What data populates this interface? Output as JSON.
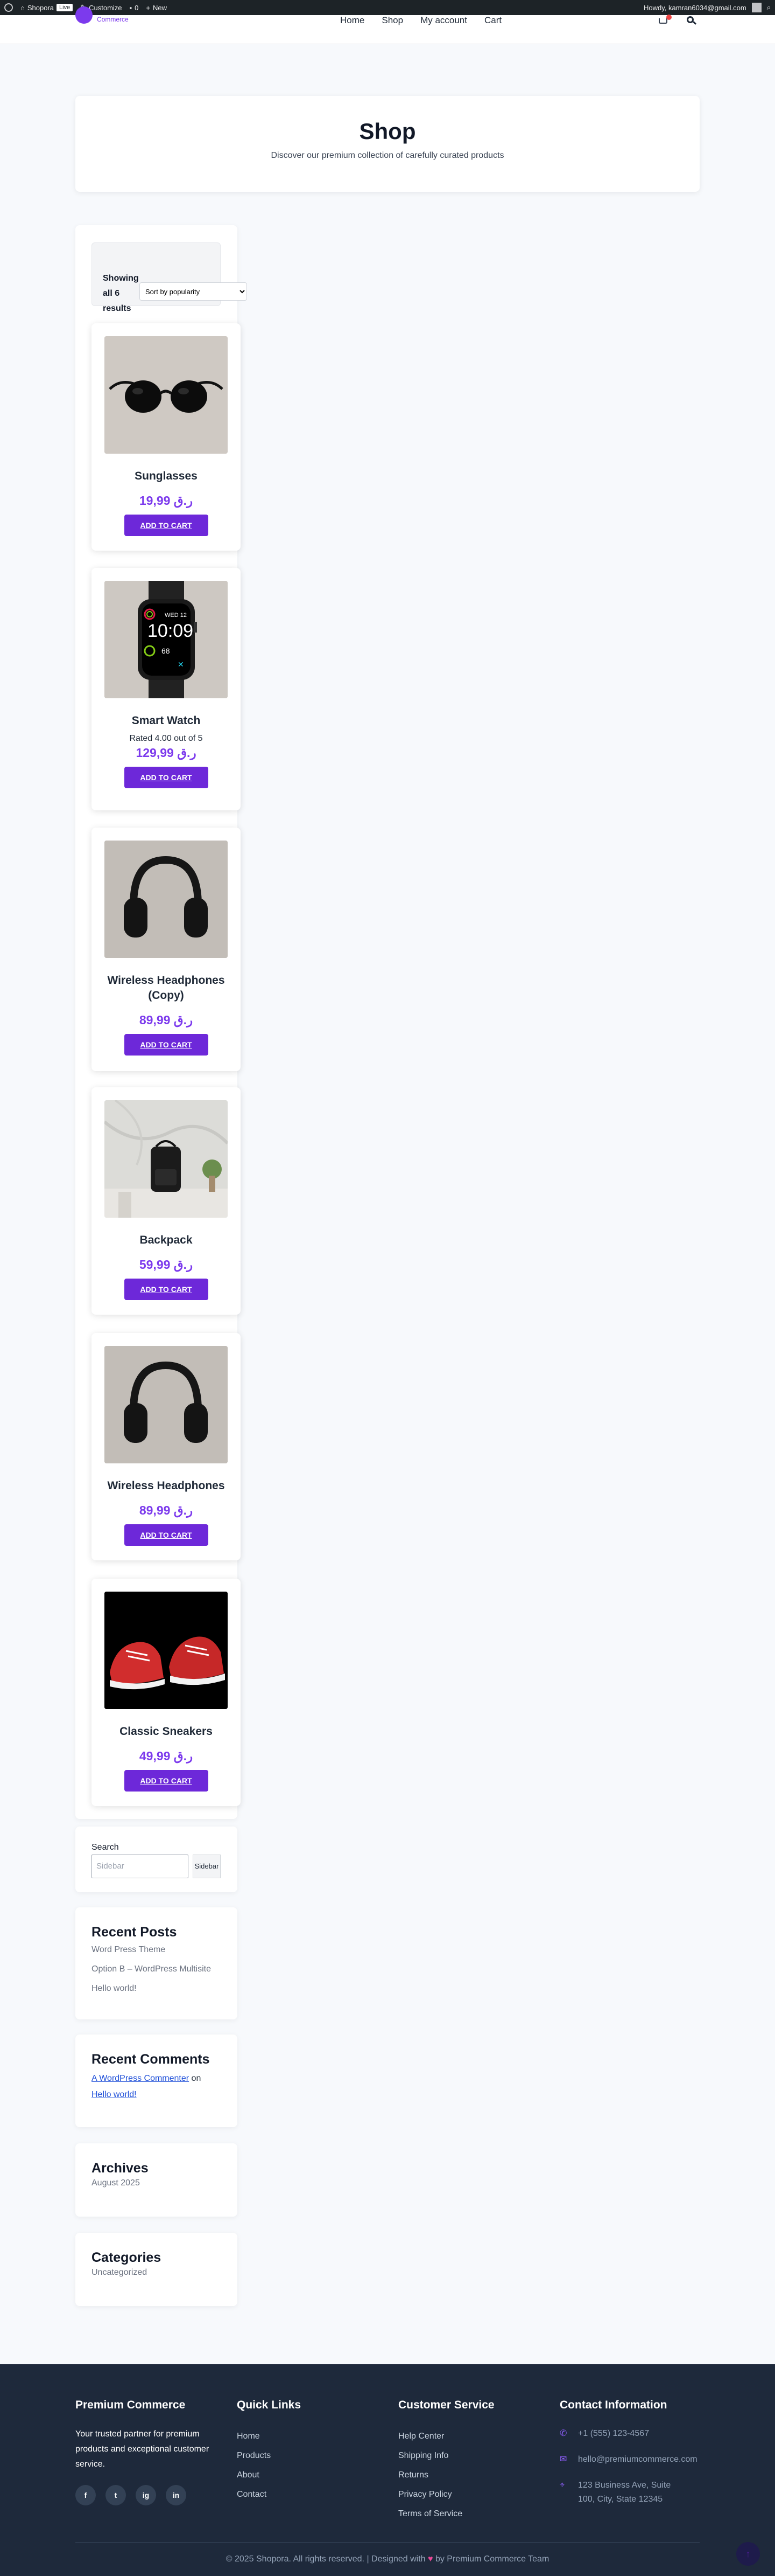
{
  "admin_bar": {
    "site_name": "Shopora",
    "live_badge": "Live",
    "customize": "Customize",
    "comments": "0",
    "new": "New",
    "howdy": "Howdy, kamran6034@gmail.com"
  },
  "header": {
    "logo_text": "Commerce",
    "nav": [
      "Home",
      "Shop",
      "My account",
      "Cart"
    ]
  },
  "hero": {
    "title": "Shop",
    "subtitle": "Discover our premium collection of carefully curated products"
  },
  "toolbar": {
    "result_count": "Showing all 6 results",
    "sort_selected": "Sort by popularity"
  },
  "products": [
    {
      "title": "Sunglasses",
      "rating_text": "",
      "price": "ر.ق 19,99",
      "button": "ADD TO CART",
      "image": "sunglasses"
    },
    {
      "title": "Smart Watch",
      "rating_text": "Rated 4.00 out of 5",
      "price": "ر.ق 129,99",
      "button": "ADD TO CART",
      "image": "smart-watch"
    },
    {
      "title": "Wireless Headphones (Copy)",
      "rating_text": "",
      "price": "ر.ق 89,99",
      "button": "ADD TO CART",
      "image": "headphones"
    },
    {
      "title": "Backpack",
      "rating_text": "",
      "price": "ر.ق 59,99",
      "button": "ADD TO CART",
      "image": "backpack"
    },
    {
      "title": "Wireless Headphones",
      "rating_text": "",
      "price": "ر.ق 89,99",
      "button": "ADD TO CART",
      "image": "headphones"
    },
    {
      "title": "Classic Sneakers",
      "rating_text": "",
      "price": "ر.ق 49,99",
      "button": "ADD TO CART",
      "image": "sneakers"
    }
  ],
  "watch_face": {
    "day": "WED 12",
    "time": "10:09",
    "bpm": "68"
  },
  "search_widget": {
    "label": "Search",
    "placeholder": "Sidebar",
    "button": "Sidebar"
  },
  "recent_posts": {
    "title": "Recent Posts",
    "items": [
      "Word Press Theme",
      "Option B – WordPress Multisite",
      "Hello world!"
    ]
  },
  "recent_comments": {
    "title": "Recent Comments",
    "author": "A WordPress Commenter",
    "on": "on",
    "post": "Hello world!"
  },
  "archives": {
    "title": "Archives",
    "items": [
      "August 2025"
    ]
  },
  "categories": {
    "title": "Categories",
    "items": [
      "Uncategorized"
    ]
  },
  "footer": {
    "brand": {
      "title": "Premium Commerce",
      "about": "Your trusted partner for premium products and exceptional customer service."
    },
    "social": [
      "f",
      "t",
      "ig",
      "in"
    ],
    "quick_links": {
      "title": "Quick Links",
      "items": [
        "Home",
        "Products",
        "About",
        "Contact"
      ]
    },
    "customer_service": {
      "title": "Customer Service",
      "items": [
        "Help Center",
        "Shipping Info",
        "Returns",
        "Privacy Policy",
        "Terms of Service"
      ]
    },
    "contact": {
      "title": "Contact Information",
      "phone": "+1 (555) 123-4567",
      "email": "hello@premiumcommerce.com",
      "address": "123 Business Ave, Suite 100, City, State 12345"
    },
    "copyright_prefix": "© 2025 Shopora. All rights reserved. | Designed with",
    "copyright_suffix": "by Premium Commerce Team"
  },
  "colors": {
    "accent": "#7c3aed",
    "button": "#6d28d9",
    "footer_bg": "#1e293b",
    "admin_bar": "#1d2327"
  }
}
